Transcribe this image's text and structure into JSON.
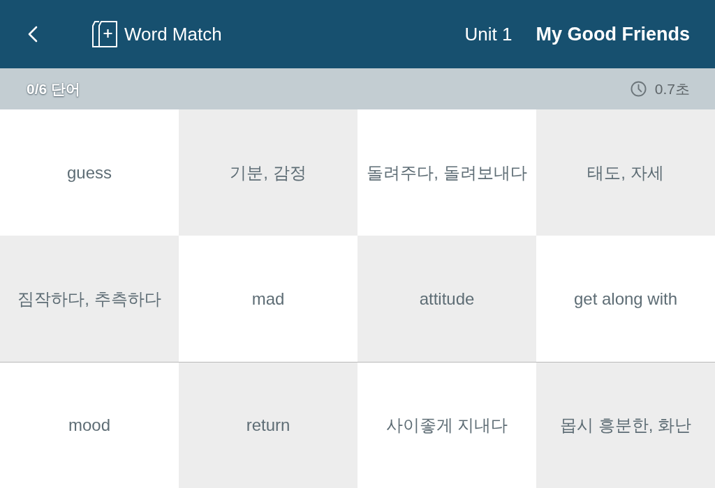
{
  "header": {
    "title": "Word Match",
    "unit": "Unit 1",
    "lesson": "My Good Friends"
  },
  "status_bar": {
    "progress": "0/6 단어",
    "timer": "0.7초"
  },
  "grid": {
    "rows": [
      [
        "guess",
        "기분, 감정",
        "돌려주다, 돌려보내다",
        "태도, 자세"
      ],
      [
        "짐작하다, 추측하다",
        "mad",
        "attitude",
        "get along with"
      ],
      [
        "mood",
        "return",
        "사이좋게 지내다",
        "몹시 흥분한, 화난"
      ]
    ]
  }
}
